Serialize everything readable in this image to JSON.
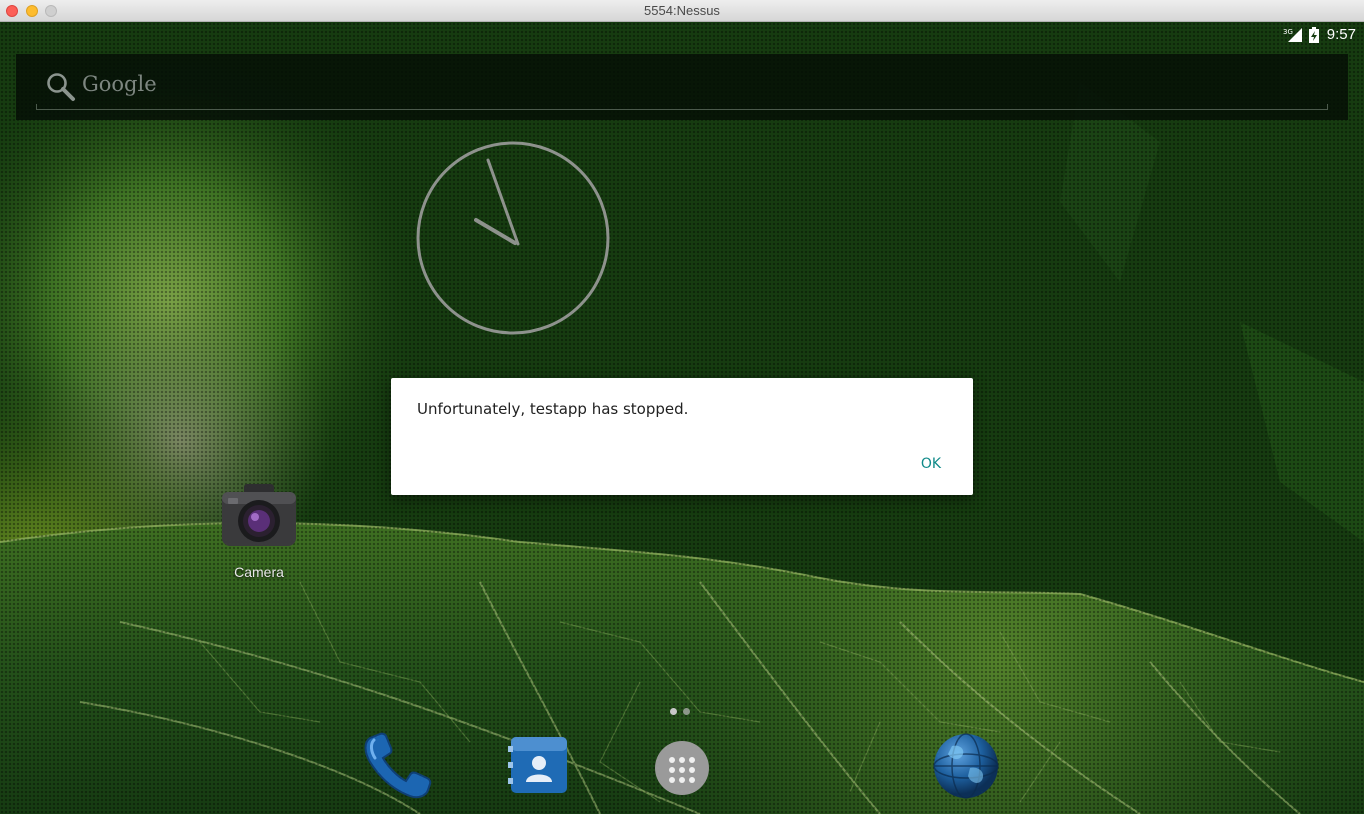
{
  "window": {
    "title": "5554:Nessus"
  },
  "status_bar": {
    "network_label": "3G",
    "time": "9:57"
  },
  "search_widget": {
    "label": "Google"
  },
  "home_apps": [
    {
      "label": "Camera",
      "icon": "camera-icon"
    }
  ],
  "dock": [
    {
      "icon": "phone-icon"
    },
    {
      "icon": "contacts-icon"
    },
    {
      "icon": "app-drawer-icon"
    },
    {
      "icon": "browser-globe-icon"
    }
  ],
  "dialog": {
    "message": "Unfortunately, testapp has stopped.",
    "ok_label": "OK"
  },
  "colors": {
    "dialog_button": "#108a89",
    "wallpaper_base": "#163c10"
  }
}
